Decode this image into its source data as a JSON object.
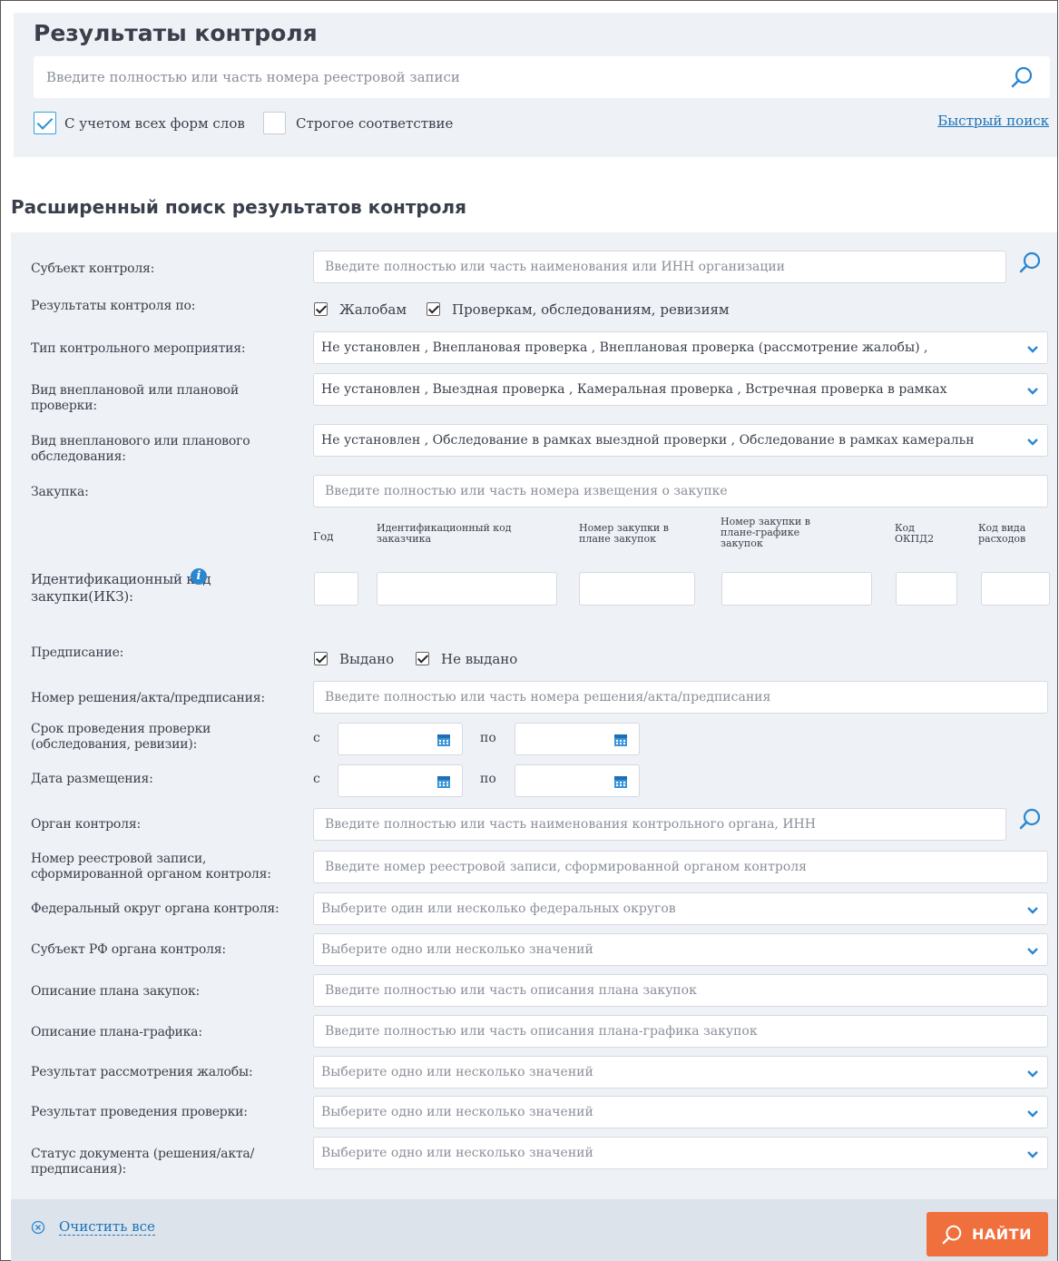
{
  "quick_search": {
    "title": "Результаты контроля",
    "placeholder": "Введите полностью или часть номера реестровой записи",
    "all_forms_label": "С учетом всех форм слов",
    "all_forms_checked": true,
    "strict_label": "Строгое соответствие",
    "strict_checked": false,
    "quick_link": "Быстрый поиск"
  },
  "advanced": {
    "title": "Расширенный поиск результатов контроля",
    "subject": {
      "label": "Субъект контроля:",
      "placeholder": "Введите полностью или часть наименования или ИНН организации"
    },
    "results_by": {
      "label": "Результаты контроля по:",
      "complaints": "Жалобам",
      "checks": "Проверкам, обследованиям, ревизиям"
    },
    "event_type": {
      "label": "Тип контрольного мероприятия:",
      "value": "Не установлен , Внеплановая проверка , Внеплановая проверка (рассмотрение жалобы) ,"
    },
    "check_kind": {
      "label": "Вид внеплановой или плановой проверки:",
      "value": "Не установлен , Выездная проверка , Камеральная проверка , Встречная проверка в рамках"
    },
    "survey_kind": {
      "label": "Вид внепланового или планового обследования:",
      "value": "Не установлен , Обследование в рамках выездной проверки , Обследование в рамках камеральн"
    },
    "purchase": {
      "label": "Закупка:",
      "placeholder": "Введите полностью или часть номера извещения о закупке"
    },
    "ikz": {
      "label": "Идентификационный код закупки(ИКЗ):",
      "info_icon": "i",
      "headers": {
        "year": "Год",
        "customer": "Идентификационный код заказчика",
        "plan_num": "Номер закупки в плане закупок",
        "schedule_num": "Номер закупки в плане-графике закупок",
        "okpd": "Код ОКПД2",
        "expense": "Код вида расходов"
      }
    },
    "prescription": {
      "label": "Предписание:",
      "issued": "Выдано",
      "not_issued": "Не выдано"
    },
    "decision_number": {
      "label": "Номер решения/акта/предписания:",
      "placeholder": "Введите полностью или часть номера решения/акта/предписания"
    },
    "check_period": {
      "label": "Срок проведения проверки (обследования, ревизии):",
      "from": "с",
      "to": "по"
    },
    "publish_date": {
      "label": "Дата размещения:",
      "from": "с",
      "to": "по"
    },
    "control_body": {
      "label": "Орган контроля:",
      "placeholder": "Введите полностью или часть наименования контрольного органа, ИНН"
    },
    "registry_number": {
      "label": "Номер реестровой записи, сформированной органом контроля:",
      "placeholder": "Введите номер реестровой записи, сформированной органом контроля"
    },
    "federal_district": {
      "label": "Федеральный округ органа контроля:",
      "placeholder": "Выберите один или несколько федеральных округов"
    },
    "region": {
      "label": "Субъект РФ органа контроля:",
      "placeholder": "Выберите одно или несколько значений"
    },
    "plan_description": {
      "label": "Описание плана закупок:",
      "placeholder": "Введите полностью или часть описания плана закупок"
    },
    "schedule_description": {
      "label": "Описание плана-графика:",
      "placeholder": "Введите полностью или часть описания плана-графика закупок"
    },
    "complaint_result": {
      "label": "Результат рассмотрения жалобы:",
      "placeholder": "Выберите одно или несколько значений"
    },
    "check_result": {
      "label": "Результат проведения проверки:",
      "placeholder": "Выберите одно или несколько значений"
    },
    "doc_status": {
      "label": "Статус документа (решения/акта/предписания):",
      "placeholder": "Выберите одно или несколько значений"
    }
  },
  "footer": {
    "clear_label": "Очистить все",
    "find_label": "НАЙТИ"
  },
  "colors": {
    "accent": "#f0703d",
    "link": "#1a73b9",
    "panel": "#eef1f5",
    "footer": "#dde3ea"
  }
}
